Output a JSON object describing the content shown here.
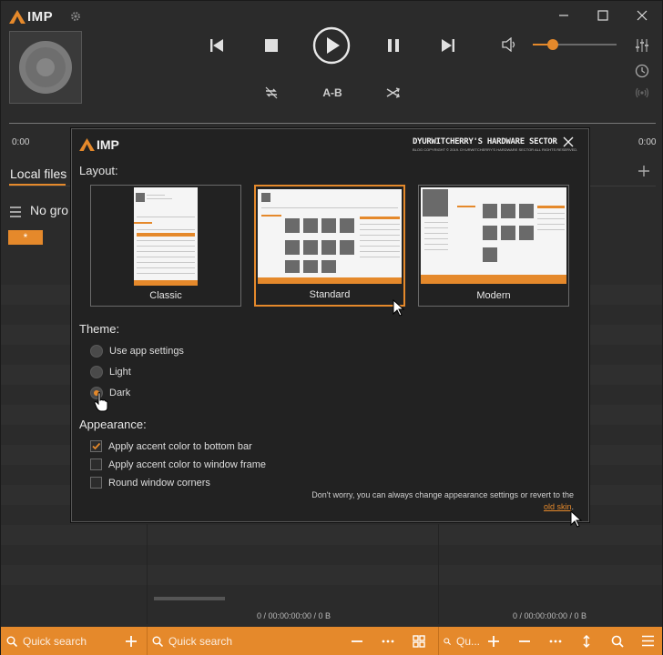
{
  "app": {
    "logo_text": "IMP"
  },
  "player": {
    "ab_label": "A-B",
    "time_left": "0:00",
    "time_right": "0:00",
    "volume_percent": 24
  },
  "panel": {
    "tab_label": "Local files",
    "group_label": "No gro",
    "star_label": "*",
    "stats": [
      "0 / 00:00:00:00 / 0 B",
      "0 / 00:00:00:00 / 0 B"
    ]
  },
  "bottom": {
    "search1_placeholder": "Quick search",
    "search2_placeholder": "Quick search",
    "search3_placeholder": "Qu..."
  },
  "dialog": {
    "logo_text": "IMP",
    "brand_title": "DYURWITCHERRY'S HARDWARE SECTOR",
    "brand_subtitle": "BLOG COPYRIGHT © 2019. DYURWITCHERRY'S HARDWARE SECTOR ALL RIGHTS RESERVED.",
    "layout_heading": "Layout:",
    "layouts": [
      {
        "label": "Classic",
        "selected": false
      },
      {
        "label": "Standard",
        "selected": true
      },
      {
        "label": "Modern",
        "selected": false
      }
    ],
    "theme_heading": "Theme:",
    "themes": [
      {
        "label": "Use app settings",
        "selected": false
      },
      {
        "label": "Light",
        "selected": false
      },
      {
        "label": "Dark",
        "selected": true
      }
    ],
    "appearance_heading": "Appearance:",
    "appearance": [
      {
        "label": "Apply accent color to bottom bar",
        "checked": true
      },
      {
        "label": "Apply accent color to window frame",
        "checked": false
      },
      {
        "label": "Round window corners",
        "checked": false
      }
    ],
    "note_text": "Don't worry, you can always change appearance settings or revert to the",
    "note_link": "old skin",
    "note_end": "."
  },
  "colors": {
    "accent": "#e5892b",
    "background": "#2b2b2b",
    "dialog_bg": "#222222"
  }
}
